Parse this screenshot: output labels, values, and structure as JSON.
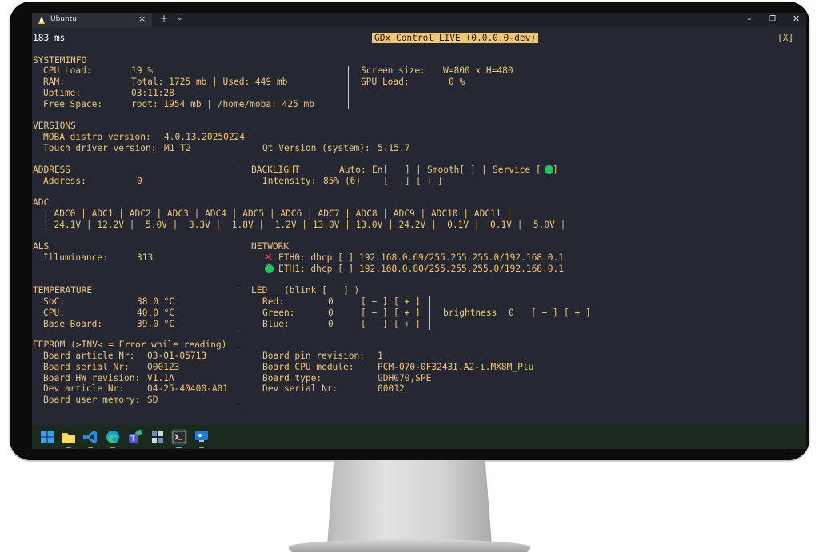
{
  "window": {
    "tab_title": "Ubuntu",
    "tab_close": "×",
    "new_tab": "+",
    "dropdown": "⌄",
    "minimize": "–",
    "restore": "❐",
    "close": "✕"
  },
  "header": {
    "timing": "183 ms",
    "title": "GDx Control LIVE (0.0.0.0-dev)",
    "close": "[X]"
  },
  "systeminfo": {
    "heading": "SYSTEMINFO",
    "cpu_label": "CPU Load:",
    "cpu_value": "19 %",
    "ram_label": "RAM:",
    "ram_value": "Total: 1725 mb | Used: 449 mb",
    "uptime_label": "Uptime:",
    "uptime_value": "03:11:28",
    "free_label": "Free Space:",
    "free_value": "root: 1954 mb | /home/moba: 425 mb",
    "screen_label": "Screen size:",
    "screen_value": "W=800 x H=480",
    "gpu_label": "GPU Load:",
    "gpu_value": "0 %"
  },
  "versions": {
    "heading": "VERSIONS",
    "distro_label": "MOBA distro version:",
    "distro_value": "4.0.13.20250224",
    "touch_label": "Touch driver version:",
    "touch_value": "M1_T2",
    "qt_label": "Qt Version (system):",
    "qt_value": "5.15.7"
  },
  "address": {
    "heading": "ADDRESS",
    "label": "Address:",
    "value": "0"
  },
  "backlight": {
    "heading": "BACKLIGHT",
    "auto_label": "Auto:",
    "en_label": "En[",
    "en_close": "]",
    "smooth": "Smooth[ ]",
    "service": "Service [",
    "service_close": "]",
    "sep1": "|",
    "sep2": "|",
    "intensity_label": "Intensity:",
    "intensity_value": "85% (6)",
    "minus": "[ − ]",
    "plus": "[ + ]"
  },
  "adc": {
    "heading": "ADC",
    "header_row": "| ADC0 | ADC1 | ADC2 | ADC3 | ADC4 | ADC5 | ADC6 | ADC7 | ADC8 | ADC9 | ADC10 | ADC11 |",
    "value_row": "| 24.1V | 12.2V |  5.0V |  3.3V |  1.8V |  1.2V | 13.0V | 13.0V | 24.2V |  0.1V |  0.1V |  5.0V |"
  },
  "als": {
    "heading": "ALS",
    "label": "Illuminance:",
    "value": "313"
  },
  "network": {
    "heading": "NETWORK",
    "eth0_status": "✕",
    "eth0": "ETH0: dhcp [ ] 192.168.0.69/255.255.255.0/192.168.0.1",
    "eth1": "ETH1: dhcp [ ] 192.168.0.80/255.255.255.0/192.168.0.1"
  },
  "temperature": {
    "heading": "TEMPERATURE",
    "soc_label": "SoC:",
    "soc_value": "38.0 °C",
    "cpu_label": "CPU:",
    "cpu_value": "40.0 °C",
    "board_label": "Base Board:",
    "board_value": "39.0 °C"
  },
  "led": {
    "heading": "LED",
    "blink": "(blink [   ] )",
    "red_label": "Red:",
    "red_value": "0",
    "green_label": "Green:",
    "green_value": "0",
    "blue_label": "Blue:",
    "blue_value": "0",
    "minus": "[ − ]",
    "plus": "[ + ]",
    "brightness_label": "brightness",
    "brightness_value": "0",
    "brightness_minus": "[ − ]",
    "brightness_plus": "[ + ]"
  },
  "eeprom": {
    "heading": "EEPROM (>INV< = Error while reading)",
    "article_label": "Board article Nr:",
    "article_value": "03-01-05713",
    "serial_label": "Board serial Nr:",
    "serial_value": "000123",
    "hw_label": "Board HW revision:",
    "hw_value": "V1.1A",
    "dev_article_label": "Dev article Nr:",
    "dev_article_value": "04-25-40400-A01",
    "memory_label": "Board user memory:",
    "memory_value": "SD",
    "pin_label": "Board pin revision:",
    "pin_value": "1",
    "cpu_module_label": "Board CPU module:",
    "cpu_module_value": "PCM-070-0F3243I.A2-i.MX8M_Plu",
    "type_label": "Board type:",
    "type_value": "GDH070,SPE",
    "dev_serial_label": "Dev serial Nr:",
    "dev_serial_value": "00012"
  },
  "taskbar": {
    "icons": [
      "windows-start-icon",
      "file-explorer-icon",
      "vscode-icon",
      "edge-icon",
      "teams-icon",
      "task-view-icon",
      "terminal-icon",
      "remote-desktop-icon"
    ]
  },
  "colors": {
    "terminal_bg": "#252833",
    "terminal_text": "#f0c674",
    "status_ok": "#22c55e",
    "status_error": "#ef4452"
  }
}
